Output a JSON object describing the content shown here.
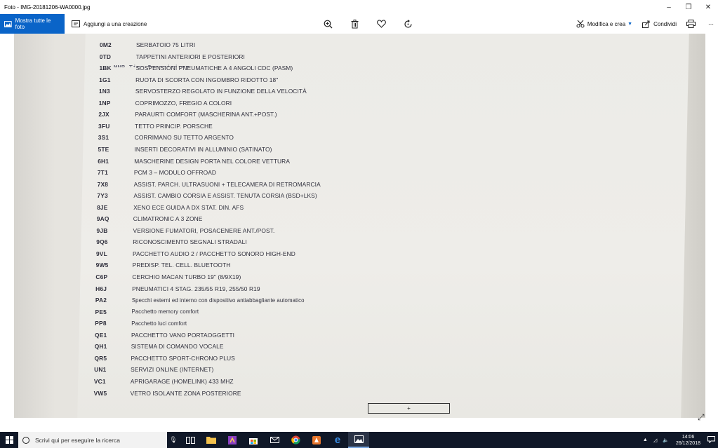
{
  "window": {
    "title": "Foto - IMG-20181206-WA0000.jpg",
    "minimize": "–",
    "restore": "❐",
    "close": "✕"
  },
  "toolbar": {
    "show_all": "Mostra tutte le foto",
    "add_creation": "Aggiungi a una creazione",
    "edit_create": "Modifica e crea",
    "share": "Condividi",
    "more": "⋯"
  },
  "document": {
    "cut_header": "MNR  Tipo  Descrizione",
    "rows": [
      {
        "code": "0M2",
        "desc": "SERBATOIO 75 LITRI"
      },
      {
        "code": "0TD",
        "desc": "TAPPETINI ANTERIORI E POSTERIORI"
      },
      {
        "code": "1BK",
        "desc": "SOSPENSIONI PNEUMATICHE A 4 ANGOLI CDC (PASM)"
      },
      {
        "code": "1G1",
        "desc": "RUOTA DI SCORTA CON INGOMBRO RIDOTTO 18\""
      },
      {
        "code": "1N3",
        "desc": "SERVOSTERZO REGOLATO IN FUNZIONE DELLA VELOCITÀ"
      },
      {
        "code": "1NP",
        "desc": "COPRIMOZZO, FREGIO A COLORI"
      },
      {
        "code": "2JX",
        "desc": "PARAURTI COMFORT (MASCHERINA ANT.+POST.)"
      },
      {
        "code": "3FU",
        "desc": "TETTO PRINCIP. PORSCHE"
      },
      {
        "code": "3S1",
        "desc": "CORRIMANO SU TETTO ARGENTO"
      },
      {
        "code": "5TE",
        "desc": "INSERTI DECORATIVI IN ALLUMINIO (SATINATO)"
      },
      {
        "code": "6H1",
        "desc": "MASCHERINE DESIGN PORTA NEL COLORE VETTURA"
      },
      {
        "code": "7T1",
        "desc": "PCM 3 – MODULO OFFROAD"
      },
      {
        "code": "7X8",
        "desc": "ASSIST. PARCH. ULTRASUONI + TELECAMERA DI RETROMARCIA"
      },
      {
        "code": "7Y3",
        "desc": "ASSIST. CAMBIO CORSIA E ASSIST. TENUTA CORSIA (BSD+LKS)"
      },
      {
        "code": "8JE",
        "desc": "XENO ECE GUIDA A DX STAT. DIN. AFS"
      },
      {
        "code": "9AQ",
        "desc": "CLIMATRONIC A 3 ZONE"
      },
      {
        "code": "9JB",
        "desc": "VERSIONE FUMATORI, POSACENERE ANT./POST."
      },
      {
        "code": "9Q6",
        "desc": "RICONOSCIMENTO SEGNALI STRADALI"
      },
      {
        "code": "9VL",
        "desc": "PACCHETTO AUDIO 2 / PACCHETTO SONORO HIGH-END"
      },
      {
        "code": "9W5",
        "desc": "PREDISP. TEL. CELL. BLUETOOTH"
      },
      {
        "code": "C6P",
        "desc": "CERCHIO MACAN TURBO 19\" (8/9X19)"
      },
      {
        "code": "H6J",
        "desc": "PNEUMATICI 4 STAG. 235/55 R19, 255/50 R19"
      },
      {
        "code": "PA2",
        "desc": "Specchi esterni ed interno con dispositivo antiabbagliante automatico"
      },
      {
        "code": "PE5",
        "desc": "Pacchetto memory comfort"
      },
      {
        "code": "PP8",
        "desc": "Pacchetto luci comfort"
      },
      {
        "code": "QE1",
        "desc": "PACCHETTO VANO PORTAOGGETTI"
      },
      {
        "code": "QH1",
        "desc": "SISTEMA DI COMANDO VOCALE"
      },
      {
        "code": "QR5",
        "desc": "PACCHETTO SPORT-CHRONO PLUS"
      },
      {
        "code": "UN1",
        "desc": "SERVIZI ONLINE (INTERNET)"
      },
      {
        "code": "VC1",
        "desc": "APRIGARAGE (HOMELINK) 433 MHZ"
      },
      {
        "code": "VW5",
        "desc": "VETRO ISOLANTE ZONA POSTERIORE"
      }
    ],
    "footer_box": "+"
  },
  "taskbar": {
    "search_placeholder": "Scrivi qui per eseguire la ricerca",
    "time": "14:06",
    "date": "26/12/2018"
  },
  "colors": {
    "accent": "#0a64c8",
    "taskbar": "#101828"
  }
}
